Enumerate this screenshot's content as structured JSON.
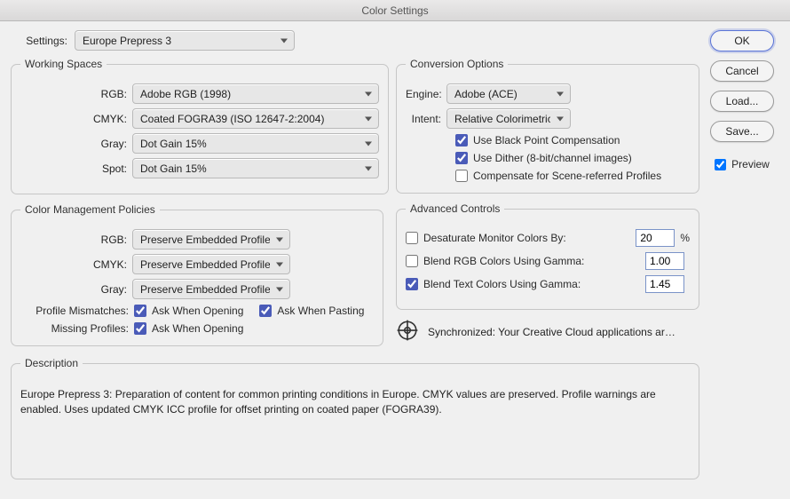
{
  "window": {
    "title": "Color Settings"
  },
  "settings": {
    "label": "Settings:",
    "value": "Europe Prepress 3"
  },
  "workingSpaces": {
    "legend": "Working Spaces",
    "rgb": {
      "label": "RGB:",
      "value": "Adobe RGB (1998)"
    },
    "cmyk": {
      "label": "CMYK:",
      "value": "Coated FOGRA39 (ISO 12647-2:2004)"
    },
    "gray": {
      "label": "Gray:",
      "value": "Dot Gain 15%"
    },
    "spot": {
      "label": "Spot:",
      "value": "Dot Gain 15%"
    }
  },
  "policies": {
    "legend": "Color Management Policies",
    "rgb": {
      "label": "RGB:",
      "value": "Preserve Embedded Profiles"
    },
    "cmyk": {
      "label": "CMYK:",
      "value": "Preserve Embedded Profiles"
    },
    "gray": {
      "label": "Gray:",
      "value": "Preserve Embedded Profiles"
    },
    "profileMismatches": {
      "label": "Profile Mismatches:",
      "askOpen": "Ask When Opening",
      "askPaste": "Ask When Pasting"
    },
    "missingProfiles": {
      "label": "Missing Profiles:",
      "askOpen": "Ask When Opening"
    }
  },
  "conversion": {
    "legend": "Conversion Options",
    "engine": {
      "label": "Engine:",
      "value": "Adobe (ACE)"
    },
    "intent": {
      "label": "Intent:",
      "value": "Relative Colorimetric"
    },
    "bpc": "Use Black Point Compensation",
    "dither": "Use Dither (8-bit/channel images)",
    "scene": "Compensate for Scene-referred Profiles"
  },
  "advanced": {
    "legend": "Advanced Controls",
    "desat": {
      "label": "Desaturate Monitor Colors By:",
      "value": "20",
      "unit": "%"
    },
    "blendRGB": {
      "label": "Blend RGB Colors Using Gamma:",
      "value": "1.00"
    },
    "blendTxt": {
      "label": "Blend Text Colors Using Gamma:",
      "value": "1.45"
    }
  },
  "sync": {
    "text": "Synchronized: Your Creative Cloud applications ar…"
  },
  "description": {
    "legend": "Description",
    "text": "Europe Prepress 3:  Preparation of content for common printing conditions in Europe. CMYK values are preserved. Profile warnings are enabled. Uses updated CMYK ICC profile for offset printing on coated paper (FOGRA39)."
  },
  "buttons": {
    "ok": "OK",
    "cancel": "Cancel",
    "load": "Load...",
    "save": "Save..."
  },
  "preview": {
    "label": "Preview"
  }
}
